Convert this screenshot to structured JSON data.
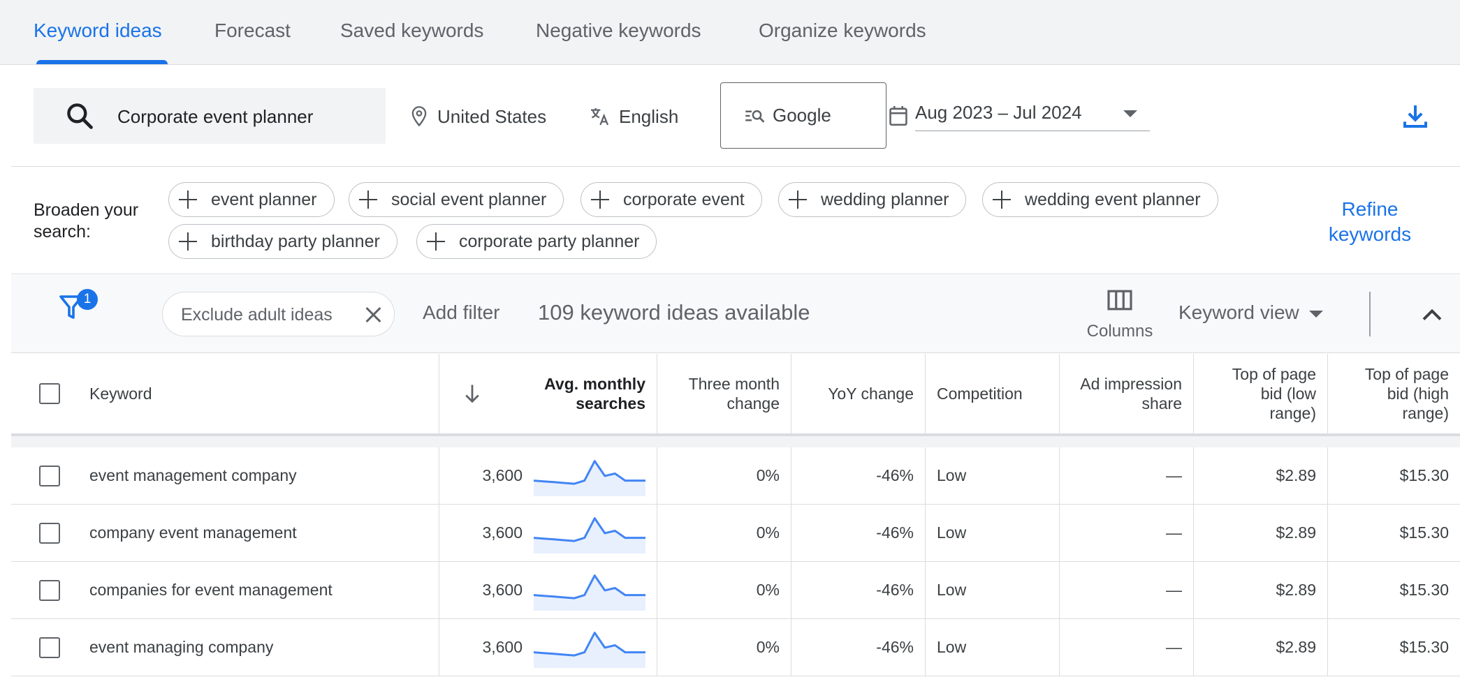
{
  "tabs": [
    "Keyword ideas",
    "Forecast",
    "Saved keywords",
    "Negative keywords",
    "Organize keywords"
  ],
  "active_tab": "Keyword ideas",
  "search": {
    "query": "Corporate event planner",
    "location": "United States",
    "language": "English",
    "network": "Google",
    "date_range": "Aug 2023 – Jul 2024"
  },
  "broaden": {
    "label": "Broaden your search:",
    "chips": [
      "event planner",
      "social event planner",
      "corporate event",
      "wedding planner",
      "wedding event planner",
      "birthday party planner",
      "corporate party planner"
    ],
    "refine": "Refine keywords"
  },
  "filterbar": {
    "badge": "1",
    "exclude_chip": "Exclude adult ideas",
    "add_filter": "Add filter",
    "ideas_count": "109 keyword ideas available",
    "columns": "Columns",
    "keyword_view": "Keyword view"
  },
  "table": {
    "headers": {
      "keyword": "Keyword",
      "avg_monthly": "Avg. monthly searches",
      "three_month": "Three month change",
      "yoy": "YoY change",
      "competition": "Competition",
      "ad_impression": "Ad impression share",
      "bid_low": "Top of page bid (low range)",
      "bid_high": "Top of page bid (high range)"
    },
    "rows": [
      {
        "keyword": "event management company",
        "avg": "3,600",
        "three_month": "0%",
        "yoy": "-46%",
        "competition": "Low",
        "ad_impression": "—",
        "bid_low": "$2.89",
        "bid_high": "$15.30"
      },
      {
        "keyword": "company event management",
        "avg": "3,600",
        "three_month": "0%",
        "yoy": "-46%",
        "competition": "Low",
        "ad_impression": "—",
        "bid_low": "$2.89",
        "bid_high": "$15.30"
      },
      {
        "keyword": "companies for event management",
        "avg": "3,600",
        "three_month": "0%",
        "yoy": "-46%",
        "competition": "Low",
        "ad_impression": "—",
        "bid_low": "$2.89",
        "bid_high": "$15.30"
      },
      {
        "keyword": "event managing company",
        "avg": "3,600",
        "three_month": "0%",
        "yoy": "-46%",
        "competition": "Low",
        "ad_impression": "—",
        "bid_low": "$2.89",
        "bid_high": "$15.30"
      }
    ],
    "sparkline_trend": [
      40,
      38,
      36,
      34,
      32,
      40,
      90,
      52,
      58,
      40,
      40,
      40
    ]
  },
  "colors": {
    "accent": "#1a73e8",
    "sparkline": "#4285f4"
  }
}
